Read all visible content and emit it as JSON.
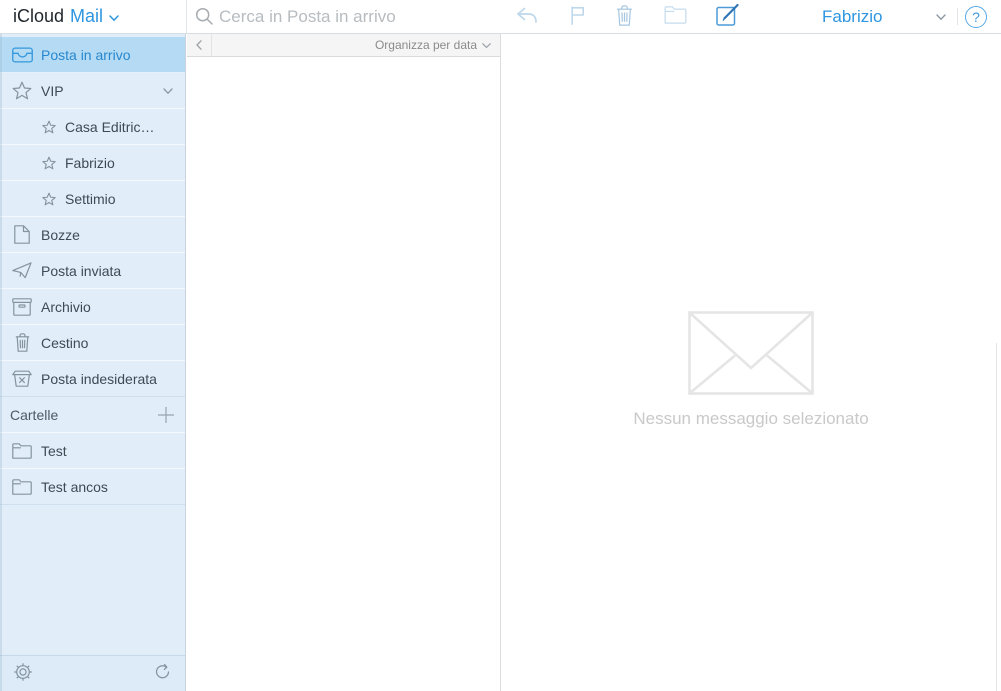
{
  "header": {
    "brand": "iCloud",
    "app": "Mail",
    "account": "Fabrizio",
    "help_label": "?"
  },
  "search": {
    "placeholder": "Cerca in Posta in arrivo"
  },
  "toolbar": {
    "buttons": [
      "reply",
      "flag",
      "delete",
      "move-to-folder",
      "compose"
    ]
  },
  "sidebar": {
    "items": [
      {
        "label": "Posta in arrivo",
        "icon": "inbox",
        "selected": true
      },
      {
        "label": "VIP",
        "icon": "star",
        "expandable": true
      },
      {
        "label": "Casa Editric…",
        "icon": "star",
        "sub": true
      },
      {
        "label": "Fabrizio",
        "icon": "star",
        "sub": true
      },
      {
        "label": "Settimio",
        "icon": "star",
        "sub": true
      },
      {
        "label": "Bozze",
        "icon": "draft"
      },
      {
        "label": "Posta inviata",
        "icon": "paper-plane"
      },
      {
        "label": "Archivio",
        "icon": "archive"
      },
      {
        "label": "Cestino",
        "icon": "trash"
      },
      {
        "label": "Posta indesiderata",
        "icon": "junk"
      }
    ],
    "folders_header": {
      "label": "Cartelle"
    },
    "folders": [
      {
        "label": "Test",
        "icon": "folder"
      },
      {
        "label": "Test ancos",
        "icon": "folder"
      }
    ]
  },
  "list": {
    "sort_label": "Organizza per data"
  },
  "reading_pane": {
    "empty_message": "Nessun messaggio selezionato"
  },
  "colors": {
    "accent": "#2e96e0",
    "sidebar_bg": "#e1eef9",
    "selected_bg": "#b4dbf3"
  }
}
